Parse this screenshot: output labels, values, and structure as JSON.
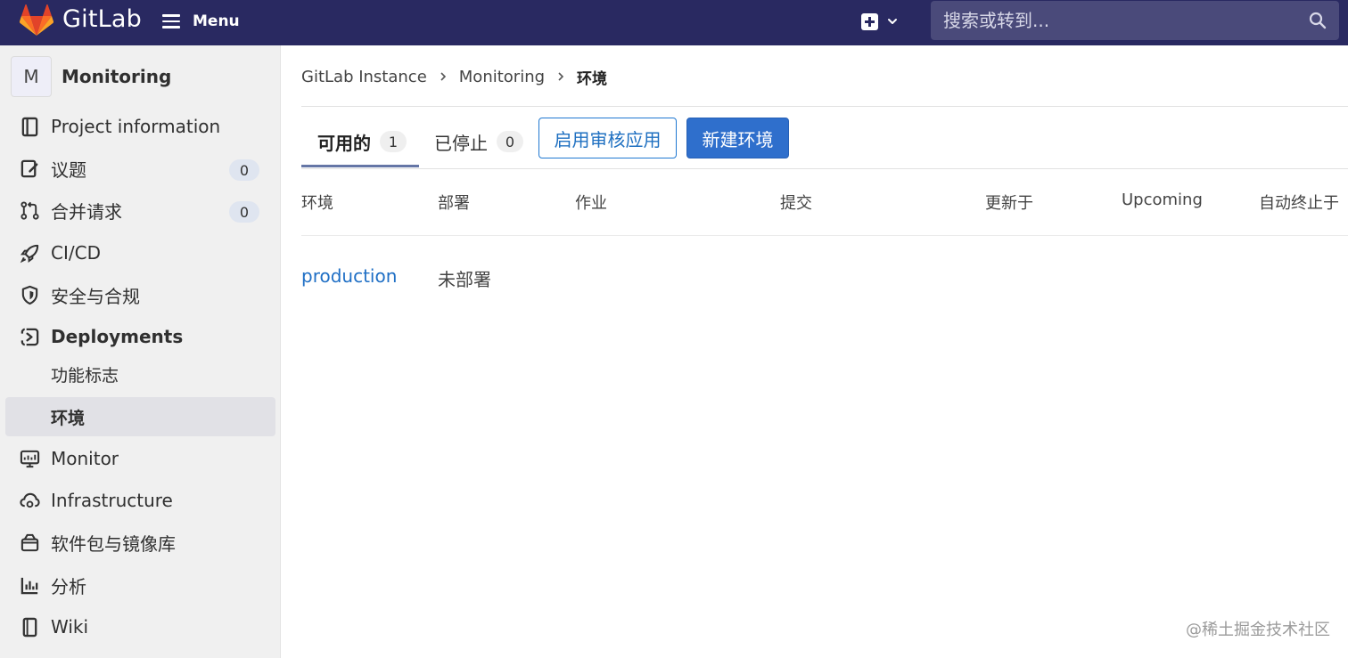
{
  "navbar": {
    "brand": "GitLab",
    "menu_label": "Menu",
    "search_placeholder": "搜索或转到..."
  },
  "sidebar": {
    "project_avatar": "M",
    "project_name": "Monitoring",
    "items": [
      {
        "label": "Project information",
        "icon": "book-icon"
      },
      {
        "label": "议题",
        "icon": "issues-icon",
        "count": "0"
      },
      {
        "label": "合并请求",
        "icon": "merge-request-icon",
        "count": "0"
      },
      {
        "label": "CI/CD",
        "icon": "rocket-icon"
      },
      {
        "label": "安全与合规",
        "icon": "shield-icon"
      },
      {
        "label": "Deployments",
        "icon": "deployments-icon"
      },
      {
        "label": "Monitor",
        "icon": "monitor-icon"
      },
      {
        "label": "Infrastructure",
        "icon": "cloud-gear-icon"
      },
      {
        "label": "软件包与镜像库",
        "icon": "package-icon"
      },
      {
        "label": "分析",
        "icon": "chart-icon"
      },
      {
        "label": "Wiki",
        "icon": "wiki-book-icon"
      }
    ],
    "sub_items": [
      {
        "label": "功能标志"
      },
      {
        "label": "环境"
      }
    ]
  },
  "breadcrumb": {
    "items": [
      "GitLab Instance",
      "Monitoring",
      "环境"
    ]
  },
  "tabs": [
    {
      "label": "可用的",
      "count": "1"
    },
    {
      "label": "已停止",
      "count": "0"
    }
  ],
  "buttons": {
    "review_apps": "启用审核应用",
    "new_environment": "新建环境"
  },
  "table": {
    "headers": [
      "环境",
      "部署",
      "作业",
      "提交",
      "更新于",
      "Upcoming",
      "自动终止于"
    ],
    "rows": [
      {
        "environment": "production",
        "deployment": "未部署"
      }
    ]
  },
  "watermark": "@稀土掘金技术社区",
  "colors": {
    "navbar_bg": "#292961",
    "link": "#1f6fc5",
    "primary_button": "#2f6fcc"
  }
}
